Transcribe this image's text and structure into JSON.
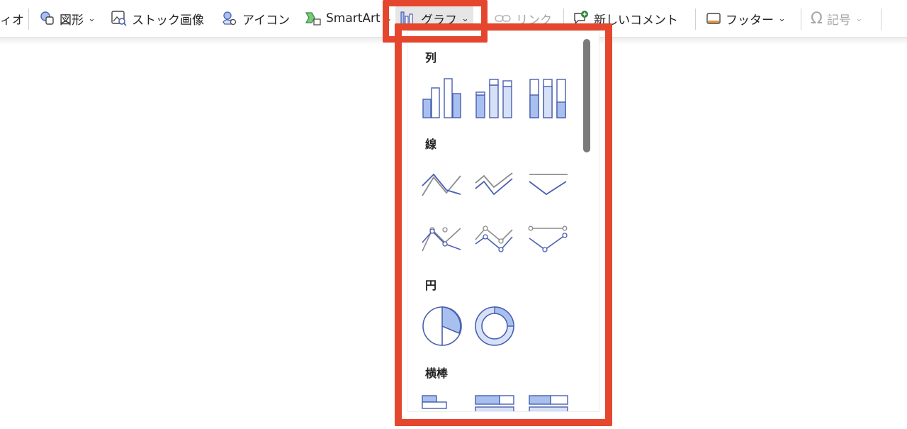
{
  "ribbon": {
    "video_label": "ィオ",
    "shapes_label": "図形",
    "stock_images_label": "ストック画像",
    "icons_label": "アイコン",
    "smartart_label": "SmartArt",
    "chart_label": "グラフ",
    "link_label": "リンク",
    "new_comment_label": "新しいコメント",
    "footer_label": "フッター",
    "symbol_label": "記号"
  },
  "chart_menu": {
    "sections": {
      "column": "列",
      "line": "線",
      "pie": "円",
      "bar": "横棒"
    }
  },
  "colors": {
    "highlight": "#e4472e",
    "chart_blue": "#4a5fb0",
    "chart_fill": "#a8c0ef",
    "chart_gray": "#8c8c8c"
  }
}
